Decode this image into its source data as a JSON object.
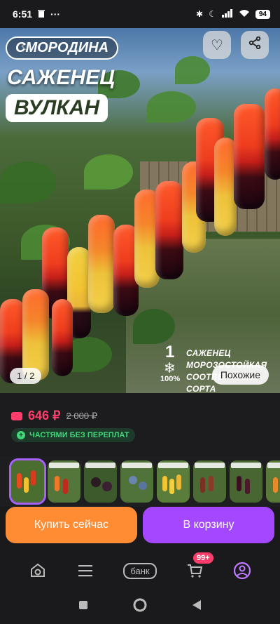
{
  "status_bar": {
    "time": "6:51",
    "dots": "···",
    "battery": "94"
  },
  "hero": {
    "title_pill": "СМОРОДИНА",
    "title_line2": "САЖЕНЕЦ",
    "title_line3": "ВУЛКАН",
    "info_number": "1",
    "info_percent": "100%",
    "info_lines": [
      "САЖЕНЕЦ",
      "МОРОЗОСТОЙКАЯ",
      "СООТВЕТСТВИЕ СОРТА"
    ],
    "pager": "1 / 2",
    "similar_label": "Похожие"
  },
  "price": {
    "current": "646 ₽",
    "old": "2 000 ₽",
    "installments": "ЧАСТЯМИ БЕЗ ПЕРЕПЛАТ"
  },
  "thumbnails": {
    "count": 8,
    "active_index": 0
  },
  "actions": {
    "buy_now": "Купить сейчас",
    "add_to_cart": "В корзину"
  },
  "bottom_nav": {
    "bank_label": "банк",
    "cart_badge": "99+"
  },
  "colors": {
    "accent_pink": "#ff3d6a",
    "buy_orange": "#ff8c33",
    "cart_purple": "#a348ff",
    "green": "#42d67a"
  }
}
